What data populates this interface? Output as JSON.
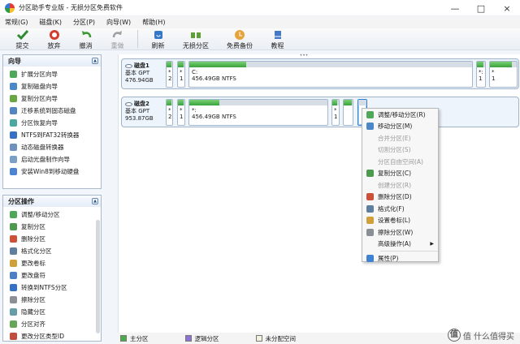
{
  "window": {
    "title": "分区助手专业版 - 无损分区免费软件",
    "controls": {
      "minimize": "—",
      "maximize": "□",
      "close": "×"
    }
  },
  "menu": [
    "常规(G)",
    "磁盘(K)",
    "分区(P)",
    "向导(W)",
    "帮助(H)"
  ],
  "toolbar": [
    {
      "label": "提交",
      "icon": "check-icon",
      "color": "#2f8b33"
    },
    {
      "label": "放弃",
      "icon": "undo-icon",
      "color": "#d43d2d"
    },
    {
      "label": "撤消",
      "icon": "undo-arrow-icon",
      "color": "#3c9a35"
    },
    {
      "label": "重做",
      "icon": "redo-icon",
      "color": "#a0a0a0",
      "disabled": true
    },
    {
      "label": "刷新",
      "icon": "refresh-icon",
      "color": "#3578c8"
    },
    {
      "label": "无损分区",
      "icon": "split-icon",
      "color": "#5da037"
    },
    {
      "label": "免费备份",
      "icon": "backup-icon",
      "color": "#e8a23a"
    },
    {
      "label": "教程",
      "icon": "book-icon",
      "color": "#4578c5"
    }
  ],
  "sidebar": {
    "wizard": {
      "title": "向导",
      "items": [
        "扩展分区向导",
        "复制磁盘向导",
        "复制分区向导",
        "迁移系统到固态磁盘",
        "分区恢复向导",
        "NTFS到FAT32转换器",
        "动态磁盘转换器",
        "启动光盘制作向导",
        "安装Win8到移动硬盘"
      ]
    },
    "operations": {
      "title": "分区操作",
      "items": [
        "调整/移动分区",
        "复制分区",
        "删除分区",
        "格式化分区",
        "更改卷标",
        "更改盘符",
        "转换到NTFS分区",
        "擦除分区",
        "隐藏分区",
        "分区对齐",
        "更改分区类型ID"
      ]
    }
  },
  "disks": [
    {
      "name": "磁盘1",
      "type": "基本 GPT",
      "size": "476.94GB",
      "partitions": [
        {
          "top": "*",
          "bottom": "2",
          "usage": 0.85
        },
        {
          "top": "*",
          "bottom": "1",
          "usage": 0.85
        },
        {
          "top": "C:",
          "bottom": "456.49GB NTFS",
          "usage": 0.2
        },
        {
          "top": "*:",
          "bottom": "1",
          "usage": 0.75
        },
        {
          "top": "*",
          "bottom": "1",
          "usage": 0.82
        }
      ]
    },
    {
      "name": "磁盘2",
      "type": "基本 GPT",
      "size": "953.87GB",
      "partitions": [
        {
          "top": "*",
          "bottom": "2",
          "usage": 0.85
        },
        {
          "top": "*",
          "bottom": "1",
          "usage": 0.85
        },
        {
          "top": "*:",
          "bottom": "456.49GB NTFS",
          "usage": 0.22
        },
        {
          "top": "*",
          "bottom": "1",
          "usage": 0.75
        },
        {
          "top": "",
          "bottom": "",
          "usage": 0.9
        },
        {
          "top": "",
          "bottom": "",
          "usage": 0.0
        }
      ]
    }
  ],
  "context_menu": [
    {
      "label": "调整/移动分区(R)",
      "icon": "resize-icon"
    },
    {
      "label": "移动分区(M)",
      "icon": "move-icon"
    },
    {
      "label": "合并分区(E)",
      "disabled": true
    },
    {
      "label": "切割分区(S)",
      "disabled": true
    },
    {
      "label": "分区自由空间(A)",
      "disabled": true
    },
    {
      "label": "复制分区(C)",
      "icon": "copy-icon"
    },
    {
      "label": "创建分区(R)",
      "disabled": true
    },
    {
      "label": "删除分区(D)",
      "icon": "delete-icon"
    },
    {
      "label": "格式化(F)",
      "icon": "format-icon"
    },
    {
      "label": "设置卷标(L)",
      "icon": "label-icon"
    },
    {
      "label": "擦除分区(W)",
      "icon": "wipe-icon"
    },
    {
      "label": "高级操作(A)",
      "submenu": true
    },
    {
      "label": "属性(P)",
      "icon": "info-icon"
    }
  ],
  "legend": [
    {
      "label": "主分区",
      "color": "#48ad48"
    },
    {
      "label": "逻辑分区",
      "color": "#8b74d6"
    },
    {
      "label": "未分配空间",
      "color": "#f4f0df"
    }
  ],
  "watermark": "值 什么值得买"
}
